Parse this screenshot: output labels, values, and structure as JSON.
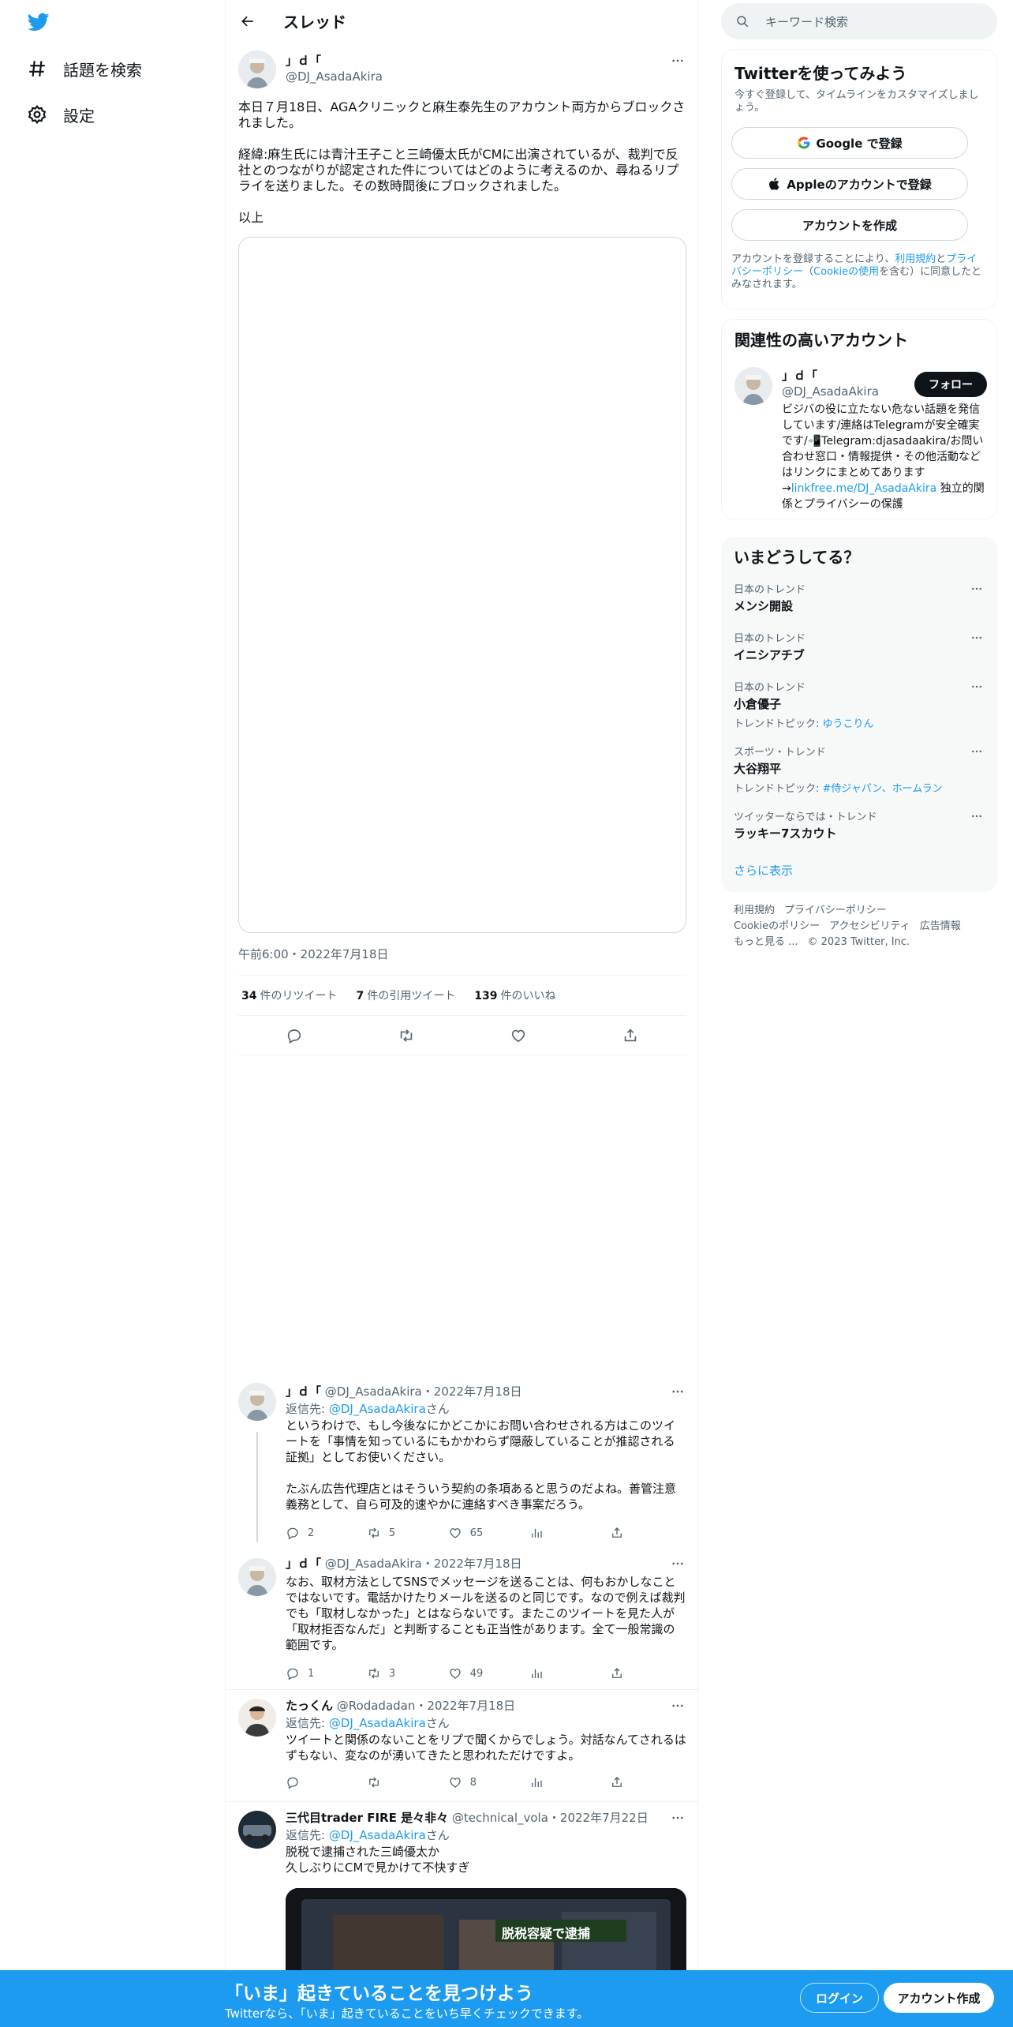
{
  "nav": {
    "explore_label": "話題を検索",
    "settings_label": "設定"
  },
  "header": {
    "title": "スレッド"
  },
  "main_tweet": {
    "name": "」ｄ「",
    "handle": "@DJ_AsadaAkira",
    "paragraphs": [
      "本日７月18日、AGAクリニックと麻生泰先生のアカウント両方からブロックされました。",
      "経緯:麻生氏には青汁王子こと三崎優太氏がCMに出演されているが、裁判で反社とのつながりが認定された件についてはどのように考えるのか、尋ねるリプライを送りました。その数時間後にブロックされました。",
      "以上"
    ],
    "timestamp": "午前6:00・2022年7月18日",
    "retweets": "34",
    "retweets_label": "件のリツイート",
    "quotes": "7",
    "quotes_label": "件の引用ツイート",
    "likes": "139",
    "likes_label": "件のいいね"
  },
  "replies": [
    {
      "name": "」ｄ「",
      "handle_date": "@DJ_AsadaAkira・2022年7月18日",
      "reply_prefix": "返信先: ",
      "reply_to": "@DJ_AsadaAkira",
      "reply_suffix": "さん",
      "text1": "というわけで、もし今後なにかどこかにお問い合わせされる方はこのツイートを「事情を知っているにもかかわらず隠蔽していることが推認される証拠」としてお使いください。",
      "text2": "たぶん広告代理店とはそういう契約の条項あると思うのだよね。善管注意義務として、自ら可及的速やかに連絡すべき事案だろう。",
      "replies": "2",
      "retweets": "5",
      "likes": "65"
    },
    {
      "name": "」ｄ「",
      "handle_date": "@DJ_AsadaAkira・2022年7月18日",
      "text1": "なお、取材方法としてSNSでメッセージを送ることは、何もおかしなことではないです。電話かけたりメールを送るのと同じです。なので例えば裁判でも「取材しなかった」とはならないです。またこのツイートを見た人が「取材拒否なんだ」と判断することも正当性があります。全て一般常識の範囲です。",
      "replies": "1",
      "retweets": "3",
      "likes": "49"
    },
    {
      "name": "たっくん",
      "handle_date": "@Rodadadan・2022年7月18日",
      "reply_prefix": "返信先: ",
      "reply_to": "@DJ_AsadaAkira",
      "reply_suffix": "さん",
      "text1": "ツイートと関係のないことをリプで聞くからでしょう。対話なんてされるはずもない、変なのが湧いてきたと思われただけですよ。",
      "replies": "",
      "retweets": "",
      "likes": "8"
    },
    {
      "name": "三代目trader FIRE 是々非々",
      "handle_date": "@technical_vola・2022年7月22日",
      "reply_prefix": "返信先: ",
      "reply_to": "@DJ_AsadaAkira",
      "reply_suffix": "さん",
      "text1": "脱税で逮捕された三崎優太か",
      "text2": "久しぶりにCMで見かけて不快すぎ",
      "media_caption": "脱税容疑で逮捕"
    }
  ],
  "right": {
    "search_placeholder": "キーワード検索",
    "signup_card": {
      "title": "Twitterを使ってみよう",
      "subtitle": "今すぐ登録して、タイムラインをカスタマイズしましょう。",
      "google": "Google で登録",
      "apple": "Appleのアカウントで登録",
      "create": "アカウントを作成",
      "legal_1": "アカウントを登録することにより、",
      "legal_terms": "利用規約",
      "legal_2": "と",
      "legal_privacy": "プライバシーポリシー",
      "legal_3": "（",
      "legal_cookie": "Cookieの使用",
      "legal_4": "を含む）に同意したとみなされます。"
    },
    "related_card": {
      "title": "関連性の高いアカウント",
      "name": "」ｄ「",
      "handle": "@DJ_AsadaAkira",
      "follow": "フォロー",
      "bio_1": "ビジバの役に立たない危ない話題を発信しています/連絡はTelegramが安全確実です/📲Telegram:djasadaakira/お問い合わせ窓口・情報提供・その他活動などはリンクにまとめてあります→",
      "bio_link": "linkfree.me/DJ_AsadaAkira",
      "bio_2": " 独立的関係とプライバシーの保護"
    },
    "trends_card": {
      "title": "いまどうしてる？",
      "trends": [
        {
          "category": "日本のトレンド",
          "title": "メンシ開設",
          "topic_prefix": "",
          "topic": ""
        },
        {
          "category": "日本のトレンド",
          "title": "イニシアチブ",
          "topic_prefix": "",
          "topic": ""
        },
        {
          "category": "日本のトレンド",
          "title": "小倉優子",
          "topic_prefix": "トレンドトピック: ",
          "topic": "ゆうこりん"
        },
        {
          "category": "スポーツ・トレンド",
          "title": "大谷翔平",
          "topic_prefix": "トレンドトピック: ",
          "topic": "#侍ジャパン、ホームラン"
        },
        {
          "category": "ツイッターならでは・トレンド",
          "title": "ラッキー7スカウト",
          "topic_prefix": "",
          "topic": ""
        }
      ],
      "show_more": "さらに表示"
    },
    "footer": {
      "terms": "利用規約",
      "privacy": "プライバシーポリシー",
      "cookie": "Cookieのポリシー",
      "accessibility": "アクセシビリティ",
      "ads": "広告情報",
      "more": "もっと見る ...",
      "copyright": "© 2023 Twitter, Inc."
    }
  },
  "bottom_bar": {
    "title": "「いま」起きていることを見つけよう",
    "subtitle": "Twitterなら、「いま」起きていることをいち早くチェックできます。",
    "login": "ログイン",
    "signup": "アカウント作成"
  },
  "colors": {
    "accent": "#1d9bf0",
    "text": "#0f1419",
    "muted": "#536471"
  }
}
